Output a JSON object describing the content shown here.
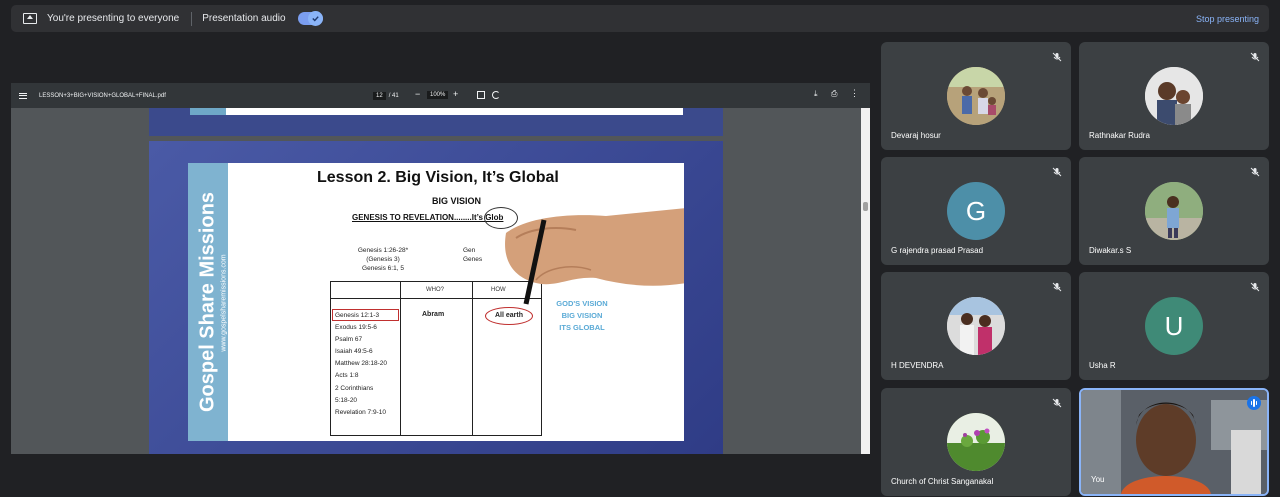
{
  "presenting_bar": {
    "status": "You're presenting to everyone",
    "audio_label": "Presentation audio",
    "audio_enabled": true,
    "stop_label": "Stop presenting"
  },
  "pdf_viewer": {
    "file_name": "LESSON+3+BIG+VISION+GLOBAL+FINAL.pdf",
    "page_current": "12",
    "page_total": "/ 41",
    "zoom": "100%",
    "zoom_out": "−",
    "zoom_in": "+"
  },
  "slide": {
    "brand": "Gospel Share Missions",
    "brand_url": "www.gospelsharemissions.com",
    "title": "Lesson 2. Big Vision, It’s Global",
    "subtitle": "BIG VISION",
    "genesis_line": "GENESIS TO REVELATION........It’s Glob",
    "refs_left": [
      "Genesis 1:26-28*",
      "(Genesis 3)",
      "Genesis 6:1, 5"
    ],
    "refs_mid": [
      "Gen",
      "Genes"
    ],
    "table_headers": [
      "WHO?",
      "HOW"
    ],
    "verses": [
      "Genesis 12:1-3",
      "Exodus 19:5-6",
      "Psalm 67",
      "Isaiah 49:5-6",
      "Matthew 28:18-20",
      "Acts 1:8",
      "2 Corinthians",
      "5:18-20",
      "Revelation 7:9-10"
    ],
    "who": "Abram",
    "how": "All earth",
    "gods_vision": [
      "GOD'S VISION",
      "BIG VISION",
      "ITS GLOBAL"
    ]
  },
  "participants": [
    {
      "name": "Devaraj hosur",
      "avatar": "photo",
      "muted": true
    },
    {
      "name": "Rathnakar Rudra",
      "avatar": "photo",
      "muted": true
    },
    {
      "name": "G rajendra prasad Prasad",
      "avatar": "letter",
      "initial": "G",
      "color": "#4d8fa8",
      "muted": true
    },
    {
      "name": "Diwakar.s S",
      "avatar": "photo",
      "muted": true
    },
    {
      "name": "H DEVENDRA",
      "avatar": "photo",
      "muted": true
    },
    {
      "name": "Usha R",
      "avatar": "letter",
      "initial": "U",
      "color": "#3f8a77",
      "muted": true
    },
    {
      "name": "Church of Christ Sanganakal",
      "avatar": "photo",
      "muted": true
    },
    {
      "name": "You",
      "avatar": "video",
      "speaking": true
    }
  ],
  "colors": {
    "background": "#202124",
    "tile": "#3c4043",
    "accent": "#8ab4f8"
  }
}
